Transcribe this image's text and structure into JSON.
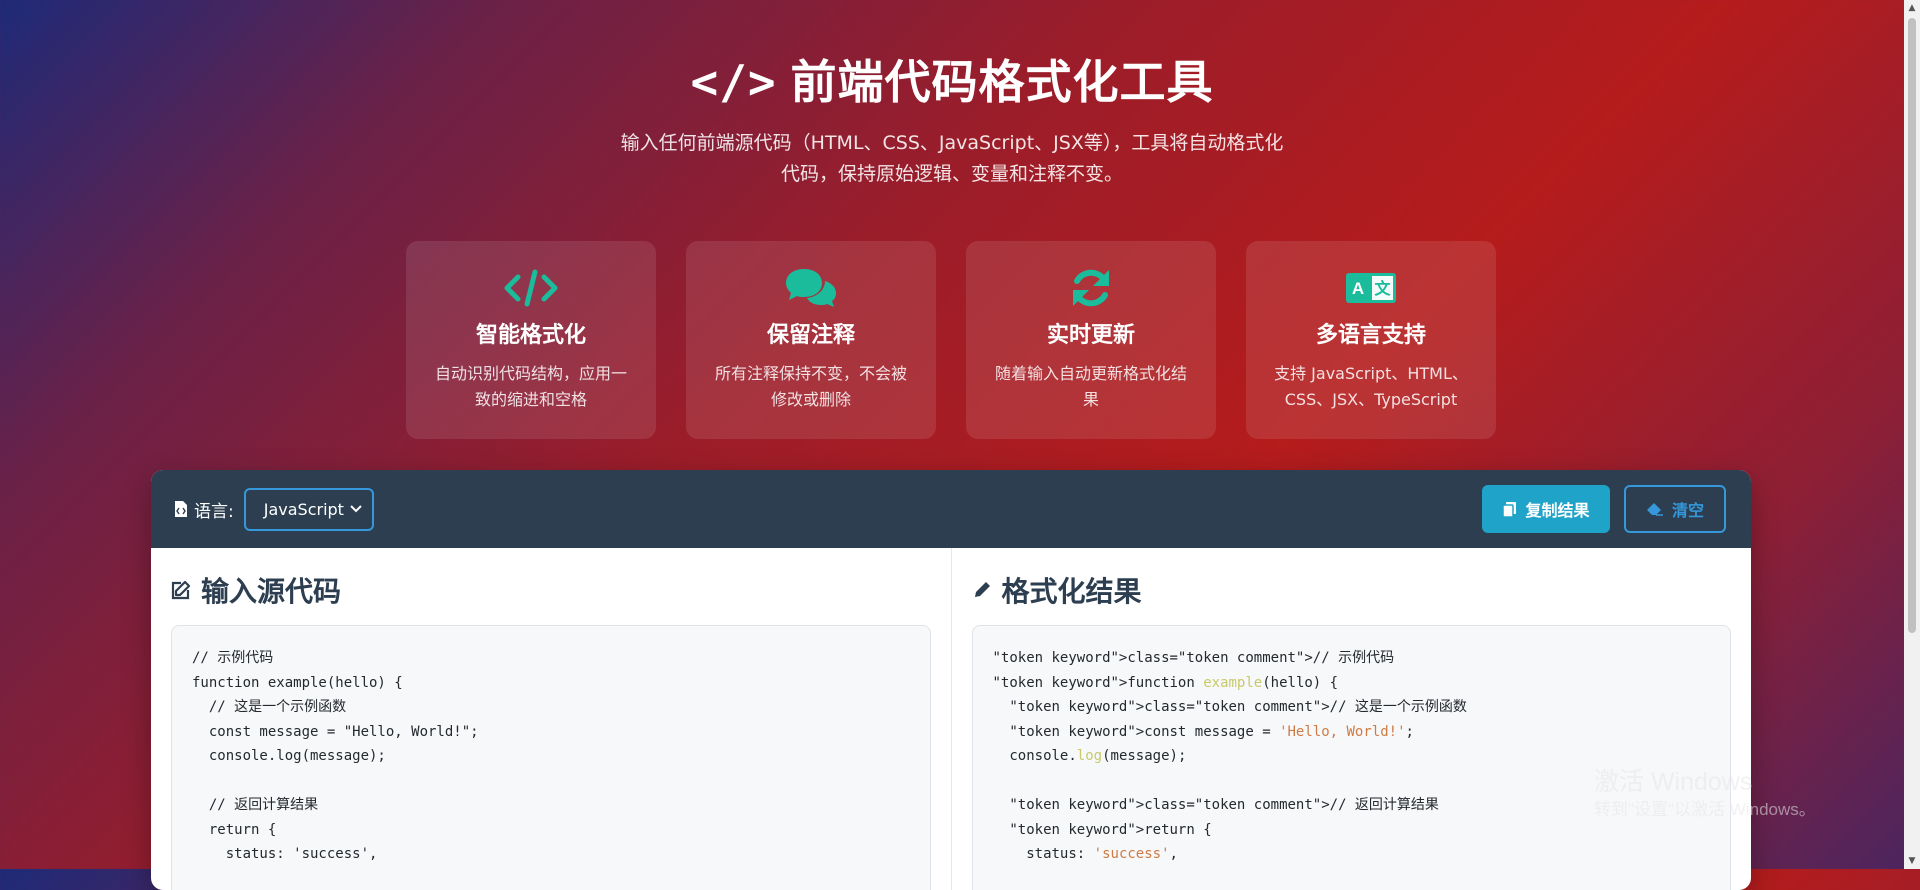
{
  "header": {
    "title_icon": "</>",
    "title": "前端代码格式化工具",
    "subtitle": "输入任何前端源代码（HTML、CSS、JavaScript、JSX等），工具将自动格式化代码，保持原始逻辑、变量和注释不变。"
  },
  "features": [
    {
      "icon": "code-icon",
      "name": "智能格式化",
      "desc": "自动识别代码结构，应用一致的缩进和空格"
    },
    {
      "icon": "comments-icon",
      "name": "保留注释",
      "desc": "所有注释保持不变，不会被修改或删除"
    },
    {
      "icon": "sync-icon",
      "name": "实时更新",
      "desc": "随着输入自动更新格式化结果"
    },
    {
      "icon": "language-icon",
      "name": "多语言支持",
      "desc": "支持 JavaScript、HTML、CSS、JSX、TypeScript"
    }
  ],
  "toolbar": {
    "lang_label": "语言:",
    "lang_value": "JavaScript",
    "copy_label": "复制结果",
    "clear_label": "清空"
  },
  "input_panel": {
    "title": "输入源代码",
    "lines": [
      "// 示例代码",
      "function example(hello) {",
      "  // 这是一个示例函数",
      "  const message = \"Hello, World!\";",
      "  console.log(message);",
      "",
      "  // 返回计算结果",
      "  return {",
      "    status: 'success',"
    ]
  },
  "output_panel": {
    "title": "格式化结果",
    "lines": [
      [
        "\"token keyword\">class=\"token comment\">// 示例代码"
      ],
      [
        "\"token keyword\">function ",
        "example",
        "(hello) {"
      ],
      [
        "  \"token keyword\">class=\"token comment\">// 这是一个示例函数"
      ],
      [
        "  \"token keyword\">const message = ",
        "'Hello, World!'",
        ";"
      ],
      [
        "  console.",
        "log",
        "(message);"
      ],
      [
        ""
      ],
      [
        "  \"token keyword\">class=\"token comment\">// 返回计算结果"
      ],
      [
        "  \"token keyword\">return {"
      ],
      [
        "    status: ",
        "'success'",
        ","
      ]
    ]
  },
  "watermark": {
    "line1": "激活 Windows",
    "line2": "转到\"设置\"以激活 Windows。"
  },
  "colors": {
    "accent": "#1abc9c",
    "toolbar_bg": "#2c3e50",
    "button_blue": "#3498db"
  }
}
